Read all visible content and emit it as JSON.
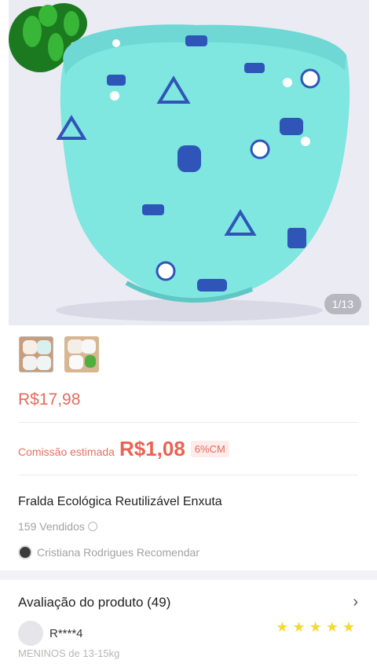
{
  "gallery": {
    "counter": "1/13"
  },
  "price": "R$17,98",
  "commission": {
    "label": "Comissão estimada",
    "amount": "R$1,08",
    "rate": "6%CM"
  },
  "product": {
    "title": "Fralda Ecológica Reutilizável Enxuta",
    "sold": "159 Vendidos",
    "recommend": "Cristiana Rodrigues Recomendar"
  },
  "reviews": {
    "title": "Avaliação do produto (49)",
    "reviewer": "R****4",
    "variant": "MENINOS de 13-15kg",
    "rating": 5
  },
  "colors": {
    "price": "#e76b5c",
    "diaper": "#7fe6e0",
    "star": "#f5d932"
  },
  "icons": [
    "chevron-right-icon",
    "clock-icon",
    "star-icon"
  ]
}
